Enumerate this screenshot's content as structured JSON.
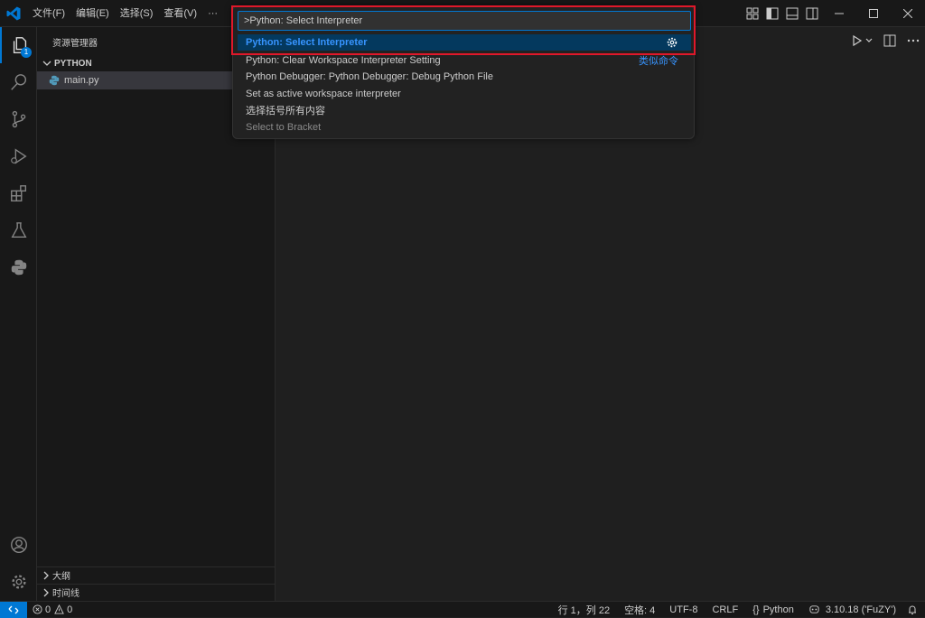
{
  "menu": [
    "文件(F)",
    "编辑(E)",
    "选择(S)",
    "查看(V)",
    "···"
  ],
  "explorer": {
    "title": "资源管理器",
    "folder": "PYTHON",
    "file": "main.py",
    "badge": "1",
    "outline": "大纲",
    "timeline": "时间线"
  },
  "quickpick": {
    "input_value": ">Python: Select Interpreter",
    "items": [
      {
        "label": "Python: Select Interpreter"
      },
      {
        "label": "Python: Clear Workspace Interpreter Setting",
        "aside": "类似命令"
      },
      {
        "label": "Python Debugger: Python Debugger: Debug Python File"
      },
      {
        "label": "Set as active workspace interpreter"
      },
      {
        "label": "选择括号所有内容"
      },
      {
        "label": "Select to Bracket"
      }
    ]
  },
  "status": {
    "errors": "0",
    "warnings": "0",
    "position": "行 1，列 22",
    "spaces": "空格: 4",
    "encoding": "UTF-8",
    "eol": "CRLF",
    "language": "Python",
    "interpreter": "3.10.18 ('FuZY')"
  },
  "colors": {
    "accent": "#0078d4",
    "highlight_box": "#e0182a",
    "link": "#3794ff"
  }
}
